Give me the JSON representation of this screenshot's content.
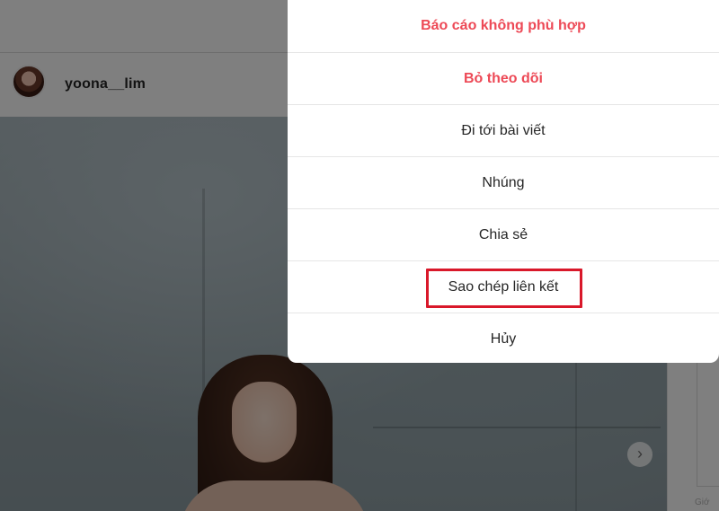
{
  "post": {
    "username": "yoona__lim",
    "next_icon": "chevron-right"
  },
  "options_menu": {
    "items": [
      {
        "label": "Báo cáo không phù hợp",
        "style": "danger"
      },
      {
        "label": "Bỏ theo dõi",
        "style": "danger"
      },
      {
        "label": "Đi tới bài viết",
        "style": "normal"
      },
      {
        "label": "Nhúng",
        "style": "normal"
      },
      {
        "label": "Chia sẻ",
        "style": "normal"
      },
      {
        "label": "Sao chép liên kết",
        "style": "normal",
        "highlighted": true
      },
      {
        "label": "Hủy",
        "style": "normal"
      }
    ]
  },
  "side_panel": {
    "hint_text": "Giớ"
  },
  "colors": {
    "danger": "#ed4956",
    "highlight_box": "#d9182a",
    "overlay": "rgba(0,0,0,0.5)"
  }
}
